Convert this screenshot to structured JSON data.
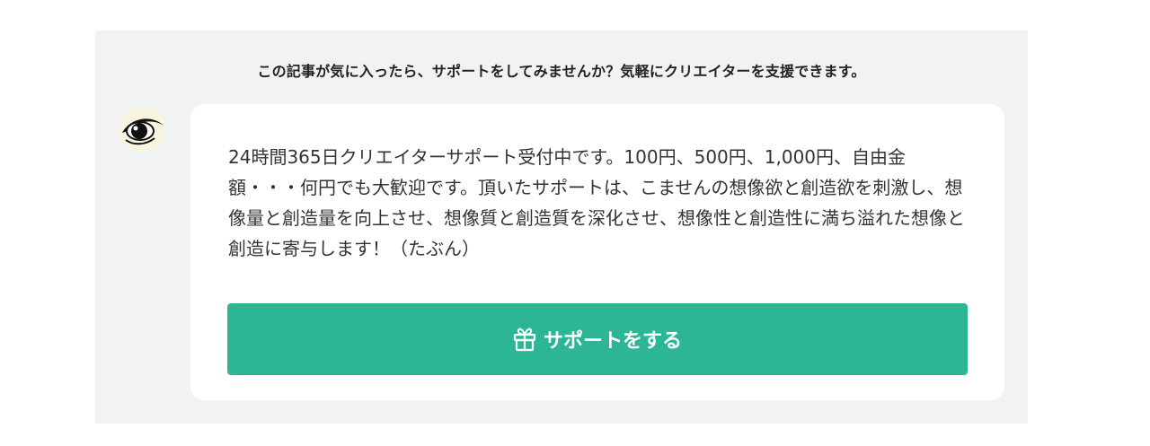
{
  "support_section": {
    "lead_text": "この記事が気に入ったら、サポートをしてみませんか？気軽にクリエイターを支援できます。",
    "avatar_icon": "creator-avatar-eye",
    "message": "24時間365日クリエイターサポート受付中です。100円、500円、1,000円、自由金額・・・何円でも大歓迎です。頂いたサポートは、こませんの想像欲と創造欲を刺激し、想像量と創造量を向上させ、想像質と創造質を深化させ、想像性と創造性に満ち溢れた想像と創造に寄与します！（たぶん）",
    "button": {
      "icon": "gift-icon",
      "label": "サポートをする"
    }
  },
  "colors": {
    "panel_background": "#f1f3f2",
    "card_background": "#ffffff",
    "button_green": "#2cb696",
    "text_primary": "#333333"
  }
}
